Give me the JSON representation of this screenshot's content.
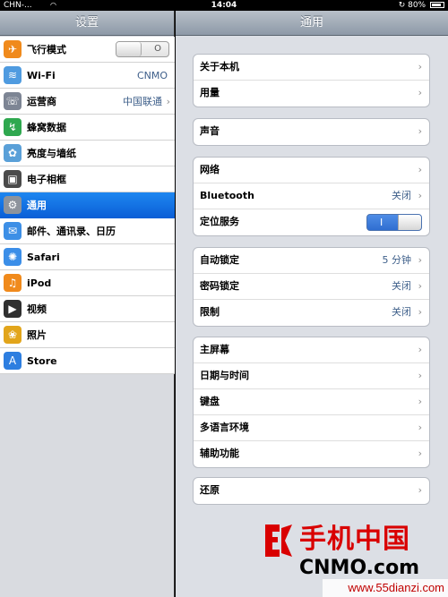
{
  "status": {
    "carrier": "CHN-...",
    "time": "14:04",
    "battery": "80%",
    "battery_level": 0.8
  },
  "left": {
    "title": "设置",
    "items": [
      {
        "label": "飞行模式",
        "icon": "airplane-icon",
        "color": "#f08a1c",
        "glyph": "✈",
        "toggle": "O"
      },
      {
        "label": "Wi-Fi",
        "icon": "wifi-icon",
        "color": "#4f9be0",
        "glyph": "≋",
        "value": "CNMO"
      },
      {
        "label": "运营商",
        "icon": "phone-icon",
        "color": "#7d8594",
        "glyph": "☏",
        "value": "中国联通"
      },
      {
        "label": "蜂窝数据",
        "icon": "cellular-data-icon",
        "color": "#2fa84f",
        "glyph": "↯"
      },
      {
        "label": "亮度与墙纸",
        "icon": "flower-icon",
        "color": "#5aa0d8",
        "glyph": "✿"
      },
      {
        "label": "电子相框",
        "icon": "picture-frame-icon",
        "color": "#4a4a4a",
        "glyph": "▣"
      },
      {
        "label": "通用",
        "icon": "gear-icon",
        "color": "#8d939c",
        "glyph": "⚙"
      },
      {
        "label": "邮件、通讯录、日历",
        "icon": "mail-icon",
        "color": "#3d8fe6",
        "glyph": "✉"
      },
      {
        "label": "Safari",
        "icon": "compass-icon",
        "color": "#3b8ee8",
        "glyph": "✺"
      },
      {
        "label": "iPod",
        "icon": "music-icon",
        "color": "#f08a1c",
        "glyph": "♫"
      },
      {
        "label": "视频",
        "icon": "clapper-icon",
        "color": "#303030",
        "glyph": "▶"
      },
      {
        "label": "照片",
        "icon": "sunflower-icon",
        "color": "#e2a51b",
        "glyph": "❀"
      },
      {
        "label": "Store",
        "icon": "store-icon",
        "color": "#2d7ee0",
        "glyph": "A"
      }
    ]
  },
  "right": {
    "title": "通用",
    "groups": [
      [
        {
          "label": "关于本机"
        },
        {
          "label": "用量"
        }
      ],
      [
        {
          "label": "声音"
        }
      ],
      [
        {
          "label": "网络"
        },
        {
          "label": "Bluetooth",
          "value": "关闭"
        },
        {
          "label": "定位服务",
          "toggle": "I"
        }
      ],
      [
        {
          "label": "自动锁定",
          "value": "5 分钟"
        },
        {
          "label": "密码锁定",
          "value": "关闭"
        },
        {
          "label": "限制",
          "value": "关闭"
        }
      ],
      [
        {
          "label": "主屏幕"
        },
        {
          "label": "日期与时间"
        },
        {
          "label": "键盘"
        },
        {
          "label": "多语言环境"
        },
        {
          "label": "辅助功能"
        }
      ],
      [
        {
          "label": "还原"
        }
      ]
    ]
  },
  "watermark": {
    "cn": "手机中国",
    "en": "CNMO.com",
    "site": "www.55dianzi.com"
  },
  "colors": {
    "selected": "#0b5fd7",
    "detail_text": "#3e5f8a",
    "watermark_red": "#d90000"
  }
}
